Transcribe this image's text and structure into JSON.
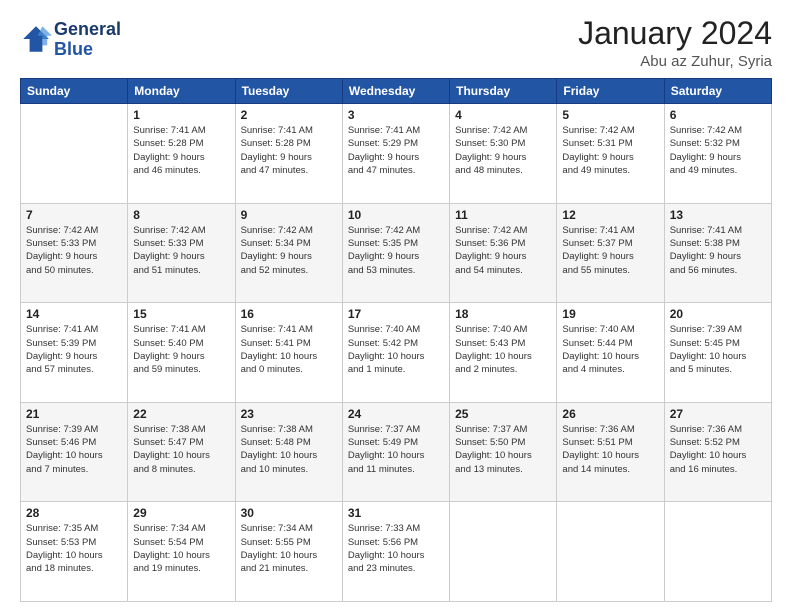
{
  "logo": {
    "line1": "General",
    "line2": "Blue"
  },
  "header": {
    "title": "January 2024",
    "subtitle": "Abu az Zuhur, Syria"
  },
  "weekdays": [
    "Sunday",
    "Monday",
    "Tuesday",
    "Wednesday",
    "Thursday",
    "Friday",
    "Saturday"
  ],
  "weeks": [
    [
      {
        "day": "",
        "sunrise": "",
        "sunset": "",
        "daylight": ""
      },
      {
        "day": "1",
        "sunrise": "Sunrise: 7:41 AM",
        "sunset": "Sunset: 5:28 PM",
        "daylight": "Daylight: 9 hours and 46 minutes."
      },
      {
        "day": "2",
        "sunrise": "Sunrise: 7:41 AM",
        "sunset": "Sunset: 5:28 PM",
        "daylight": "Daylight: 9 hours and 47 minutes."
      },
      {
        "day": "3",
        "sunrise": "Sunrise: 7:41 AM",
        "sunset": "Sunset: 5:29 PM",
        "daylight": "Daylight: 9 hours and 47 minutes."
      },
      {
        "day": "4",
        "sunrise": "Sunrise: 7:42 AM",
        "sunset": "Sunset: 5:30 PM",
        "daylight": "Daylight: 9 hours and 48 minutes."
      },
      {
        "day": "5",
        "sunrise": "Sunrise: 7:42 AM",
        "sunset": "Sunset: 5:31 PM",
        "daylight": "Daylight: 9 hours and 49 minutes."
      },
      {
        "day": "6",
        "sunrise": "Sunrise: 7:42 AM",
        "sunset": "Sunset: 5:32 PM",
        "daylight": "Daylight: 9 hours and 49 minutes."
      }
    ],
    [
      {
        "day": "7",
        "sunrise": "Sunrise: 7:42 AM",
        "sunset": "Sunset: 5:33 PM",
        "daylight": "Daylight: 9 hours and 50 minutes."
      },
      {
        "day": "8",
        "sunrise": "Sunrise: 7:42 AM",
        "sunset": "Sunset: 5:33 PM",
        "daylight": "Daylight: 9 hours and 51 minutes."
      },
      {
        "day": "9",
        "sunrise": "Sunrise: 7:42 AM",
        "sunset": "Sunset: 5:34 PM",
        "daylight": "Daylight: 9 hours and 52 minutes."
      },
      {
        "day": "10",
        "sunrise": "Sunrise: 7:42 AM",
        "sunset": "Sunset: 5:35 PM",
        "daylight": "Daylight: 9 hours and 53 minutes."
      },
      {
        "day": "11",
        "sunrise": "Sunrise: 7:42 AM",
        "sunset": "Sunset: 5:36 PM",
        "daylight": "Daylight: 9 hours and 54 minutes."
      },
      {
        "day": "12",
        "sunrise": "Sunrise: 7:41 AM",
        "sunset": "Sunset: 5:37 PM",
        "daylight": "Daylight: 9 hours and 55 minutes."
      },
      {
        "day": "13",
        "sunrise": "Sunrise: 7:41 AM",
        "sunset": "Sunset: 5:38 PM",
        "daylight": "Daylight: 9 hours and 56 minutes."
      }
    ],
    [
      {
        "day": "14",
        "sunrise": "Sunrise: 7:41 AM",
        "sunset": "Sunset: 5:39 PM",
        "daylight": "Daylight: 9 hours and 57 minutes."
      },
      {
        "day": "15",
        "sunrise": "Sunrise: 7:41 AM",
        "sunset": "Sunset: 5:40 PM",
        "daylight": "Daylight: 9 hours and 59 minutes."
      },
      {
        "day": "16",
        "sunrise": "Sunrise: 7:41 AM",
        "sunset": "Sunset: 5:41 PM",
        "daylight": "Daylight: 10 hours and 0 minutes."
      },
      {
        "day": "17",
        "sunrise": "Sunrise: 7:40 AM",
        "sunset": "Sunset: 5:42 PM",
        "daylight": "Daylight: 10 hours and 1 minute."
      },
      {
        "day": "18",
        "sunrise": "Sunrise: 7:40 AM",
        "sunset": "Sunset: 5:43 PM",
        "daylight": "Daylight: 10 hours and 2 minutes."
      },
      {
        "day": "19",
        "sunrise": "Sunrise: 7:40 AM",
        "sunset": "Sunset: 5:44 PM",
        "daylight": "Daylight: 10 hours and 4 minutes."
      },
      {
        "day": "20",
        "sunrise": "Sunrise: 7:39 AM",
        "sunset": "Sunset: 5:45 PM",
        "daylight": "Daylight: 10 hours and 5 minutes."
      }
    ],
    [
      {
        "day": "21",
        "sunrise": "Sunrise: 7:39 AM",
        "sunset": "Sunset: 5:46 PM",
        "daylight": "Daylight: 10 hours and 7 minutes."
      },
      {
        "day": "22",
        "sunrise": "Sunrise: 7:38 AM",
        "sunset": "Sunset: 5:47 PM",
        "daylight": "Daylight: 10 hours and 8 minutes."
      },
      {
        "day": "23",
        "sunrise": "Sunrise: 7:38 AM",
        "sunset": "Sunset: 5:48 PM",
        "daylight": "Daylight: 10 hours and 10 minutes."
      },
      {
        "day": "24",
        "sunrise": "Sunrise: 7:37 AM",
        "sunset": "Sunset: 5:49 PM",
        "daylight": "Daylight: 10 hours and 11 minutes."
      },
      {
        "day": "25",
        "sunrise": "Sunrise: 7:37 AM",
        "sunset": "Sunset: 5:50 PM",
        "daylight": "Daylight: 10 hours and 13 minutes."
      },
      {
        "day": "26",
        "sunrise": "Sunrise: 7:36 AM",
        "sunset": "Sunset: 5:51 PM",
        "daylight": "Daylight: 10 hours and 14 minutes."
      },
      {
        "day": "27",
        "sunrise": "Sunrise: 7:36 AM",
        "sunset": "Sunset: 5:52 PM",
        "daylight": "Daylight: 10 hours and 16 minutes."
      }
    ],
    [
      {
        "day": "28",
        "sunrise": "Sunrise: 7:35 AM",
        "sunset": "Sunset: 5:53 PM",
        "daylight": "Daylight: 10 hours and 18 minutes."
      },
      {
        "day": "29",
        "sunrise": "Sunrise: 7:34 AM",
        "sunset": "Sunset: 5:54 PM",
        "daylight": "Daylight: 10 hours and 19 minutes."
      },
      {
        "day": "30",
        "sunrise": "Sunrise: 7:34 AM",
        "sunset": "Sunset: 5:55 PM",
        "daylight": "Daylight: 10 hours and 21 minutes."
      },
      {
        "day": "31",
        "sunrise": "Sunrise: 7:33 AM",
        "sunset": "Sunset: 5:56 PM",
        "daylight": "Daylight: 10 hours and 23 minutes."
      },
      {
        "day": "",
        "sunrise": "",
        "sunset": "",
        "daylight": ""
      },
      {
        "day": "",
        "sunrise": "",
        "sunset": "",
        "daylight": ""
      },
      {
        "day": "",
        "sunrise": "",
        "sunset": "",
        "daylight": ""
      }
    ]
  ]
}
